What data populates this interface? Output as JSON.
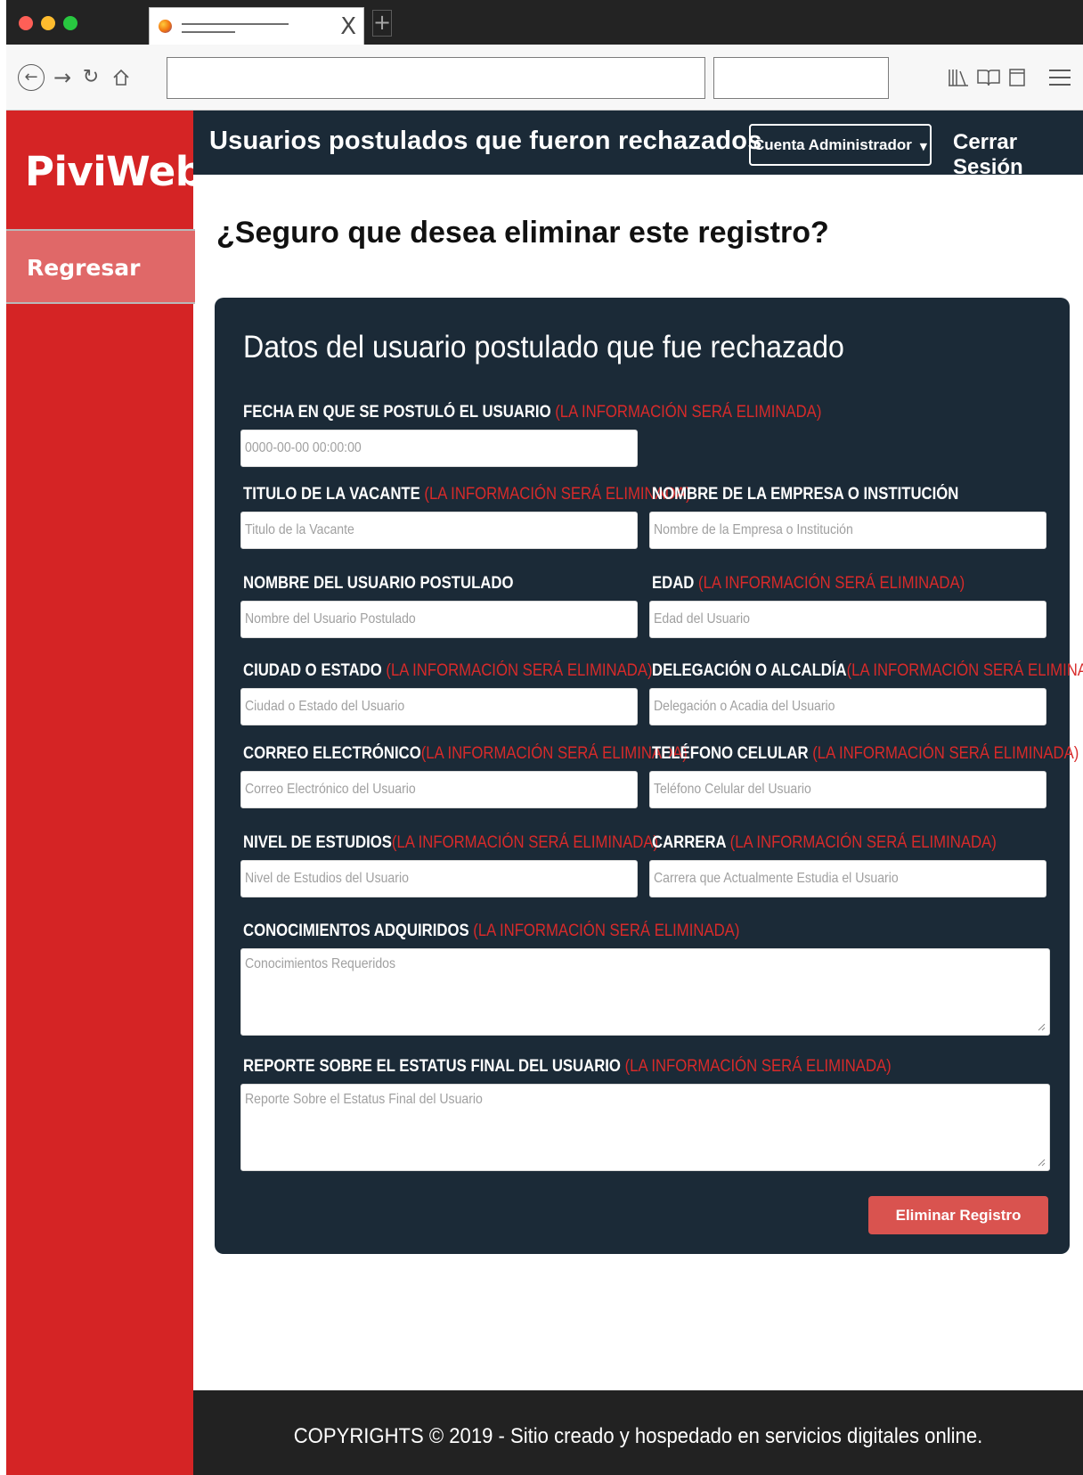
{
  "browser": {
    "tab_close": "X",
    "new_tab": "+",
    "traffic_colors": [
      "#fe5f57",
      "#febc2e",
      "#28c840"
    ]
  },
  "brand": {
    "logo": "PiviWeb"
  },
  "sidebar": {
    "back_label": "Regresar"
  },
  "header": {
    "title": "Usuarios postulados que fueron rechazados",
    "account_button": "Cuenta Administrador",
    "logout": "Cerrar Sesión"
  },
  "main": {
    "question": "¿Seguro que desea eliminar este registro?",
    "card_title": "Datos del usuario postulado que fue rechazado",
    "warning": "(LA INFORMACIÓN SERÁ ELIMINADA)",
    "fields": {
      "fecha": {
        "label": "FECHA EN QUE SE POSTULÓ EL USUARIO",
        "value": "0000-00-00 00:00:00"
      },
      "titulo": {
        "label": "TITULO DE LA VACANTE",
        "placeholder": "Titulo de la Vacante"
      },
      "empresa": {
        "label": "NOMBRE DE LA EMPRESA O INSTITUCIÓN",
        "placeholder": "Nombre de la Empresa o Institución"
      },
      "nombre": {
        "label": "NOMBRE DEL USUARIO POSTULADO",
        "placeholder": "Nombre del Usuario Postulado"
      },
      "edad": {
        "label": "EDAD",
        "placeholder": "Edad del Usuario"
      },
      "ciudad": {
        "label": "CIUDAD O ESTADO",
        "placeholder": "Ciudad o Estado del Usuario"
      },
      "delegacion": {
        "label": "DELEGACIÓN O ALCALDÍA",
        "placeholder": "Delegación o Acadia del Usuario"
      },
      "correo": {
        "label": "CORREO ELECTRÓNICO",
        "placeholder": "Correo Electrónico del Usuario"
      },
      "telefono": {
        "label": "TELÉFONO CELULAR",
        "placeholder": "Teléfono Celular del Usuario"
      },
      "nivel": {
        "label": "NIVEL DE ESTUDIOS",
        "placeholder": "Nivel de Estudios del Usuario"
      },
      "carrera": {
        "label": "CARRERA",
        "placeholder": "Carrera que  Actualmente Estudia el Usuario"
      },
      "conocimientos": {
        "label": "CONOCIMIENTOS ADQUIRIDOS",
        "placeholder": "Conocimientos Requeridos"
      },
      "reporte": {
        "label": "REPORTE SOBRE EL ESTATUS FINAL DEL USUARIO",
        "placeholder": "Reporte Sobre el Estatus Final del Usuario"
      }
    },
    "delete_button": "Eliminar Registro"
  },
  "footer": {
    "text": "COPYRIGHTS © 2019 - Sitio creado y hospedado en servicios digitales online."
  }
}
